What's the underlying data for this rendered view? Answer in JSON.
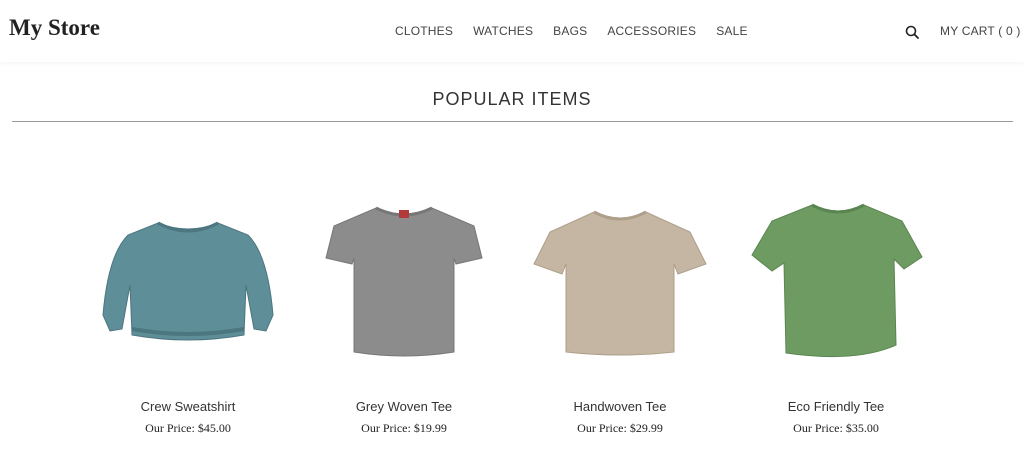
{
  "header": {
    "logo": "My Store",
    "nav": [
      "CLOTHES",
      "WATCHES",
      "BAGS",
      "ACCESSORIES",
      "SALE"
    ],
    "search_icon": "search-icon",
    "cart_label": "MY CART ( 0 )"
  },
  "section": {
    "title": "POPULAR ITEMS"
  },
  "products": [
    {
      "name": "Crew Sweatshirt",
      "price": "Our Price: $45.00",
      "color": "#5e8e98",
      "icon": "sweatshirt-image"
    },
    {
      "name": "Grey Woven Tee",
      "price": "Our Price: $19.99",
      "color": "#8c8c8c",
      "icon": "tshirt-image"
    },
    {
      "name": "Handwoven Tee",
      "price": "Our Price: $29.99",
      "color": "#c4b6a2",
      "icon": "tshirt-image"
    },
    {
      "name": "Eco Friendly Tee",
      "price": "Our Price: $35.00",
      "color": "#6e9b62",
      "icon": "tshirt-image"
    }
  ]
}
